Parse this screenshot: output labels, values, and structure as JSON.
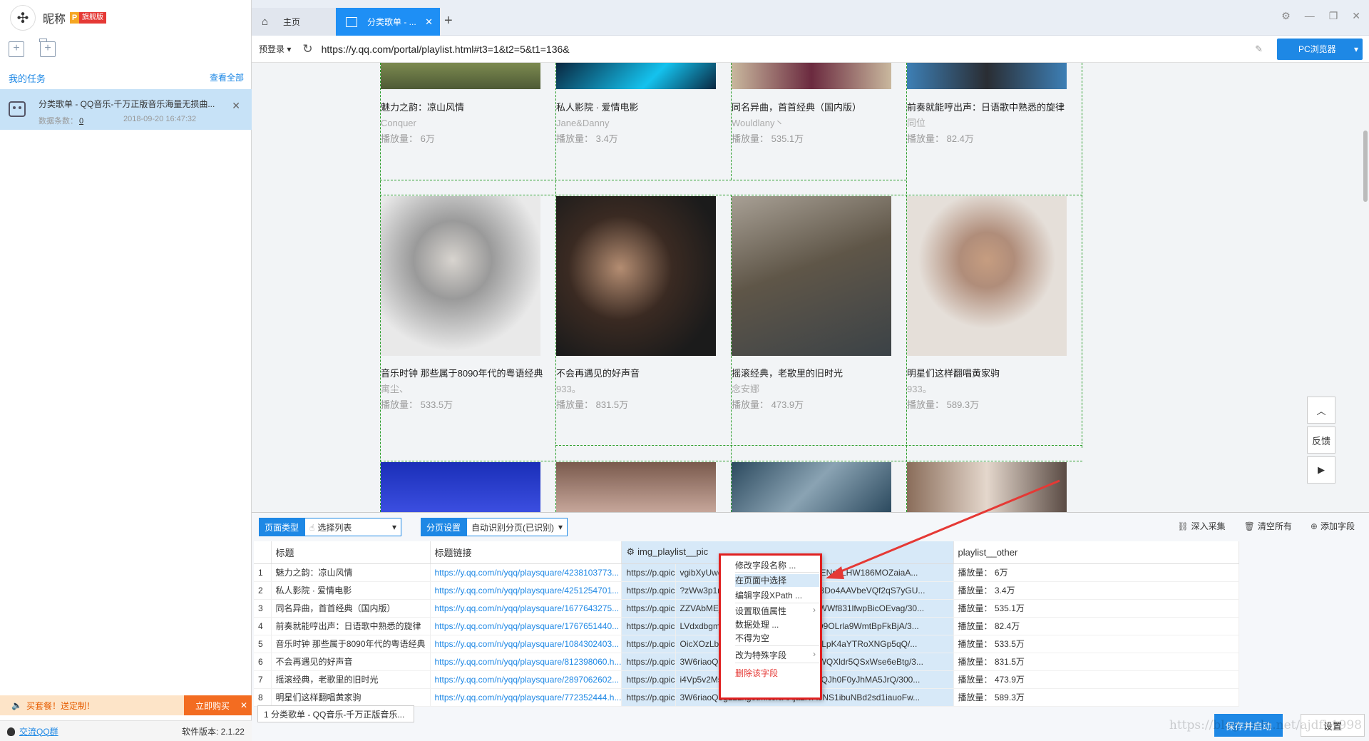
{
  "sidebar": {
    "nickname": "昵称",
    "vip_letter": "P",
    "vip_badge": "旗舰版",
    "my_tasks": "我的任务",
    "view_all": "查看全部",
    "task": {
      "name": "分类歌单 - QQ音乐-千万正版音乐海量无损曲...",
      "count_label": "数据条数：",
      "count": "0",
      "date": "2018-09-20 16:47:32"
    },
    "promo_text": "买套餐！送定制！",
    "promo_button": "立即购买",
    "qq_group": "交流QQ群",
    "version": "软件版本: 2.1.22"
  },
  "tabs": {
    "home": "主页",
    "active": "分类歌单 - ..."
  },
  "address": {
    "login": "预登录",
    "url": "https://y.qq.com/portal/playlist.html#t3=1&t2=5&t1=136&",
    "browser_button": "PC浏览器"
  },
  "cards_row1": [
    {
      "title": "魅力之韵：凉山风情",
      "author": "Conquer",
      "plays": "播放量：  6万"
    },
    {
      "title": "私人影院 · 爱情电影",
      "author": "Jane&Danny",
      "plays": "播放量：  3.4万"
    },
    {
      "title": "同名异曲，首首经典（国内版）",
      "author": "Wouldlany丶",
      "plays": "播放量：  535.1万"
    },
    {
      "title": "前奏就能哼出声：日语歌中熟悉的旋律",
      "author": "同位",
      "plays": "播放量：  82.4万"
    }
  ],
  "cards_row2": [
    {
      "title": "音乐时钟 那些属于8090年代的粤语经典",
      "author": "寓尘、",
      "plays": "播放量：  533.5万"
    },
    {
      "title": "不会再遇见的好声音",
      "author": "933。",
      "plays": "播放量：  831.5万"
    },
    {
      "title": "摇滚经典，老歌里的旧时光",
      "author": "念安娜",
      "plays": "播放量：  473.9万"
    },
    {
      "title": "明星们这样翻唱黄家驹",
      "author": "933。",
      "plays": "播放量：  589.3万"
    }
  ],
  "float": {
    "feedback": "反馈"
  },
  "panel": {
    "page_type_label": "页面类型",
    "select_list": "选择列表",
    "paging_label": "分页设置",
    "paging_value": "自动识别分页(已识别)",
    "deep_collect": "深入采集",
    "clear_all": "清空所有",
    "add_field": "添加字段",
    "columns": [
      "标题",
      "标题链接",
      "img_playlist__pic",
      "playlist__other"
    ],
    "rows": [
      [
        "1",
        "魅力之韵：凉山风情",
        "https://y.qq.com/n/yqq/playsquare/4238103773...",
        "https://p.qpic",
        "vgibXyUwdLTNJiamlRdlZzB2CicXdGENricLHW186MOZaiaA...",
        "播放量：  6万"
      ],
      [
        "2",
        "私人影院 · 爱情电影",
        "https://y.qq.com/n/yqq/playsquare/4251254701...",
        "https://p.qpic",
        "?zWw3p1m4U86ndGHX3WQtmVqicBDo4AAVbeVQf2qS7yGU...",
        "播放量：  3.4万"
      ],
      [
        "3",
        "同名异曲，首首经典（国内版）",
        "https://y.qq.com/n/yqq/playsquare/1677643275...",
        "https://p.qpic",
        "ZZVAbMEjG3JatSmsjdTMcKylBib8lxWWf831lfwpBicOEvag/30...",
        "播放量：  535.1万"
      ],
      [
        "4",
        "前奏就能哼出声：日语歌中熟悉的旋律",
        "https://y.qq.com/n/yqq/playsquare/1767651440...",
        "https://p.qpic",
        "LVdxdbgmSUdTN6rwYHto9XjzHSMO9OLrla9WmtBpFkBjA/3...",
        "播放量：  82.4万"
      ],
      [
        "5",
        "音乐时钟 那些属于8090年代的粤语经典",
        "https://y.qq.com/n/yqq/playsquare/1084302403...",
        "https://p.qpic",
        "OicXOzLb0rrJibF1ibyCs9zTZDdlbw0jLpK4aYTRoXNGp5qQ/...",
        "播放量：  533.5万"
      ],
      [
        "6",
        "不会再遇见的好声音",
        "https://y.qq.com/n/yqq/playsquare/812398060.h...",
        "https://p.qpic",
        "3W6riaoQ5gL22xo7Cstw5csibBZlaEWQXldr5QSxWse6eBtg/3...",
        "播放量：  831.5万"
      ],
      [
        "7",
        "摇滚经典，老歌里的旧时光",
        "https://y.qq.com/n/yqq/playsquare/2897062602...",
        "https://p.qpic",
        "i4Vp5v2Ms96bstz1UglbjHN4frlF50UxQJh0F0yJhMA5JrQ/300...",
        "播放量：  473.9万"
      ],
      [
        "8",
        "明星们这样翻唱黄家驹",
        "https://y.qq.com/n/yqq/playsquare/772352444.h...",
        "https://p.qpic",
        "3W6riaoQ5gL22xg0tmicJicAAja2lVAoNS1ibuNBd2sd1iauoFw...",
        "播放量：  589.3万"
      ]
    ],
    "bottom_tab": "1 分类歌单 - QQ音乐-千万正版音乐...",
    "save_start": "保存并启动",
    "settings": "设置",
    "watermark": "https://blog.csdn.net/ajdfh1998"
  },
  "context_menu": {
    "rename": "修改字段名称 ...",
    "select_in_page": "在页面中选择",
    "edit_xpath": "编辑字段XPath ...",
    "value_attr": "设置取值属性",
    "data_process": "数据处理 ...",
    "not_empty": "不得为空",
    "special_field": "改为特殊字段",
    "delete": "删除该字段"
  },
  "colors": {
    "accent": "#1e88e5",
    "highlight_border": "#e02020",
    "selection_dash": "#2a9d2a"
  }
}
